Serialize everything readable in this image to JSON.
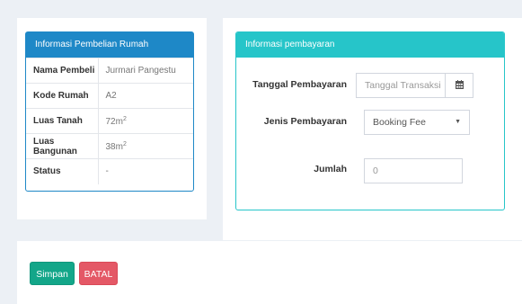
{
  "info_rumah": {
    "title": "Informasi Pembelian Rumah",
    "rows": [
      {
        "label": "Nama Pembeli",
        "value": "Jurmari Pangestu"
      },
      {
        "label": "Kode Rumah",
        "value": "A2"
      },
      {
        "label": "Luas Tanah",
        "value": "72m",
        "sup": "2"
      },
      {
        "label": "Luas Bangunan",
        "value": "38m",
        "sup": "2"
      },
      {
        "label": "Status",
        "value": "-"
      }
    ]
  },
  "info_pembayaran": {
    "title": "Informasi pembayaran",
    "tanggal": {
      "label": "Tanggal Pembayaran",
      "placeholder": "Tanggal Transaksi",
      "icon": "calendar-icon"
    },
    "jenis": {
      "label": "Jenis Pembayaran",
      "selected": "Booking Fee",
      "icon": "caret-down-icon"
    },
    "jumlah": {
      "label": "Jumlah",
      "placeholder": "0"
    }
  },
  "actions": {
    "save_label": "Simpan",
    "cancel_label": "BATAL"
  },
  "colors": {
    "background": "#ecf0f5",
    "primary": "#1e88c7",
    "info": "#26c5c9",
    "success": "#13a689",
    "danger": "#e45866"
  }
}
